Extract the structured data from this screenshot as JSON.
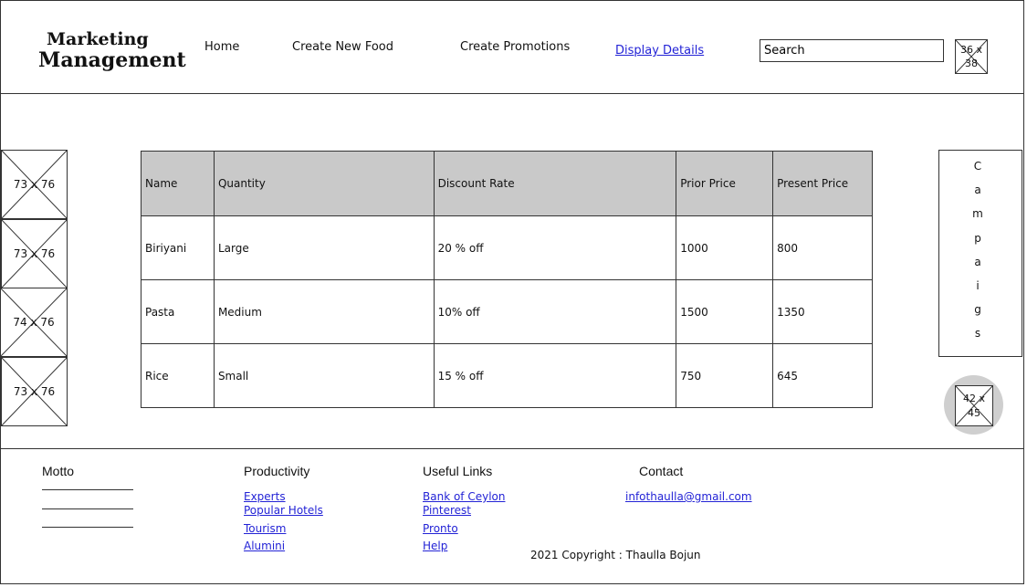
{
  "header": {
    "logo_line1": "Marketing",
    "logo_line2": "Management",
    "nav": [
      "Home",
      "Create New Food",
      "Create Promotions",
      "Display Details"
    ],
    "search_value": "Search",
    "avatar_placeholder": "36 x 38"
  },
  "left_images": [
    "73 x 76",
    "73 x 76",
    "74 x 76",
    "73 x 76"
  ],
  "table": {
    "headers": [
      "Name",
      "Quantity",
      "Discount Rate",
      "Prior Price",
      "Present Price"
    ],
    "rows": [
      [
        "Biriyani",
        "Large",
        "20 % off",
        "1000",
        "800"
      ],
      [
        "Pasta",
        "Medium",
        "10% off",
        "1500",
        "1350"
      ],
      [
        "Rice",
        "Small",
        "15 % off",
        "750",
        "645"
      ]
    ]
  },
  "campaigns": [
    "C",
    "a",
    "m",
    "p",
    "a",
    "i",
    "g",
    "s"
  ],
  "round_button_placeholder": "42 x 45",
  "footer": {
    "motto": "Motto",
    "productivity": {
      "title": "Productivity",
      "links": [
        "Experts",
        "Popular Hotels",
        "Tourism",
        "Alumini"
      ]
    },
    "useful_links": {
      "title": "Useful Links",
      "links": [
        "Bank of Ceylon",
        "Pinterest",
        "Pronto",
        "Help"
      ]
    },
    "contact": {
      "title": "Contact",
      "email": "infothaulla@gmail.com"
    },
    "copyright": "2021 Copyright : Thaulla Bojun"
  },
  "colors": {
    "link": "#2323d6",
    "table_header_bg": "#c9c9c9",
    "circle_bg": "#cfcfcf"
  }
}
